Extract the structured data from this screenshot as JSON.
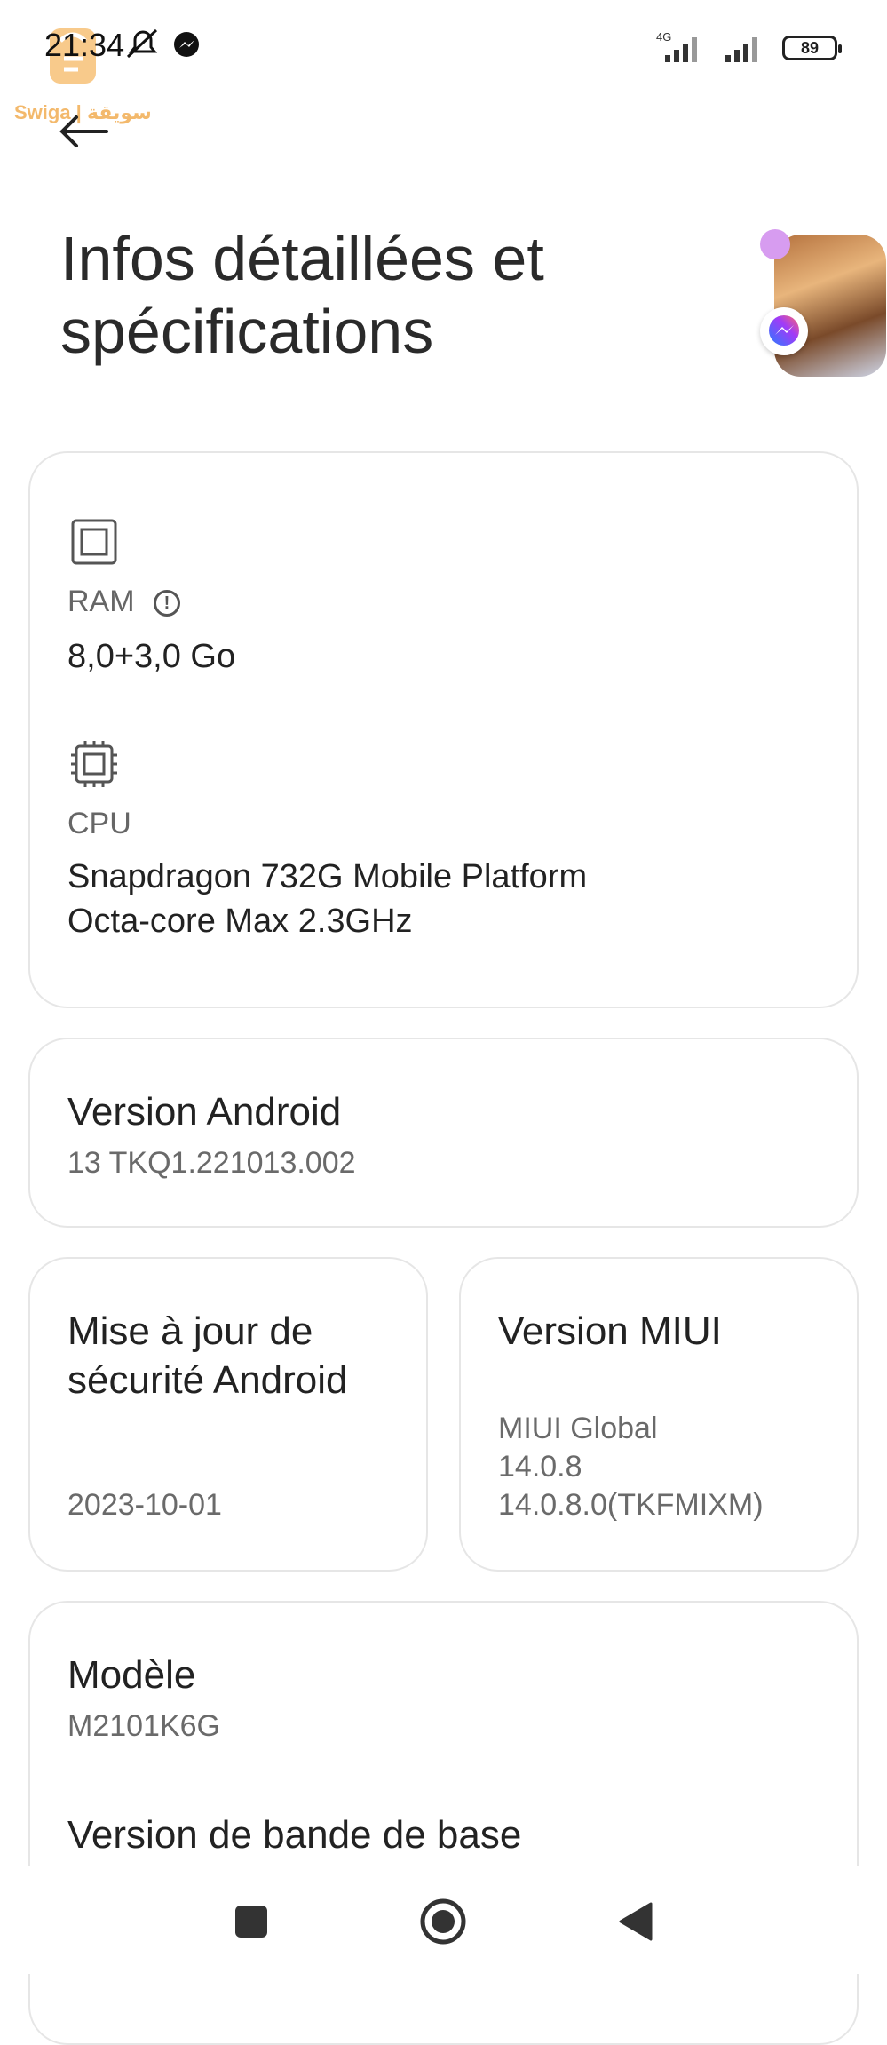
{
  "status_bar": {
    "time": "21:34",
    "network_label": "4G",
    "battery": "89"
  },
  "watermark": {
    "text": "Swiga | سويقة"
  },
  "page": {
    "title": "Infos détaillées et spécifications"
  },
  "specs_card": {
    "ram": {
      "label": "RAM",
      "value": "8,0+3,0 Go"
    },
    "cpu": {
      "label": "CPU",
      "value_line1": "Snapdragon 732G Mobile Platform",
      "value_line2": "Octa-core Max 2.3GHz"
    }
  },
  "android_card": {
    "title": "Version Android",
    "value": "13 TKQ1.221013.002"
  },
  "security_card": {
    "title_line1": "Mise à jour de",
    "title_line2": "sécurité Android",
    "value": "2023-10-01"
  },
  "miui_card": {
    "title": "Version MIUI",
    "value_line1": "MIUI Global",
    "value_line2": "14.0.8",
    "value_line3": "14.0.8.0(TKFMIXM)"
  },
  "model_card": {
    "title": "Modèle",
    "value": "M2101K6G",
    "baseband_title": "Version de bande de base"
  },
  "colors": {
    "accent_bubble": "#d79cf0",
    "messenger_blue": "#6c63ff"
  }
}
